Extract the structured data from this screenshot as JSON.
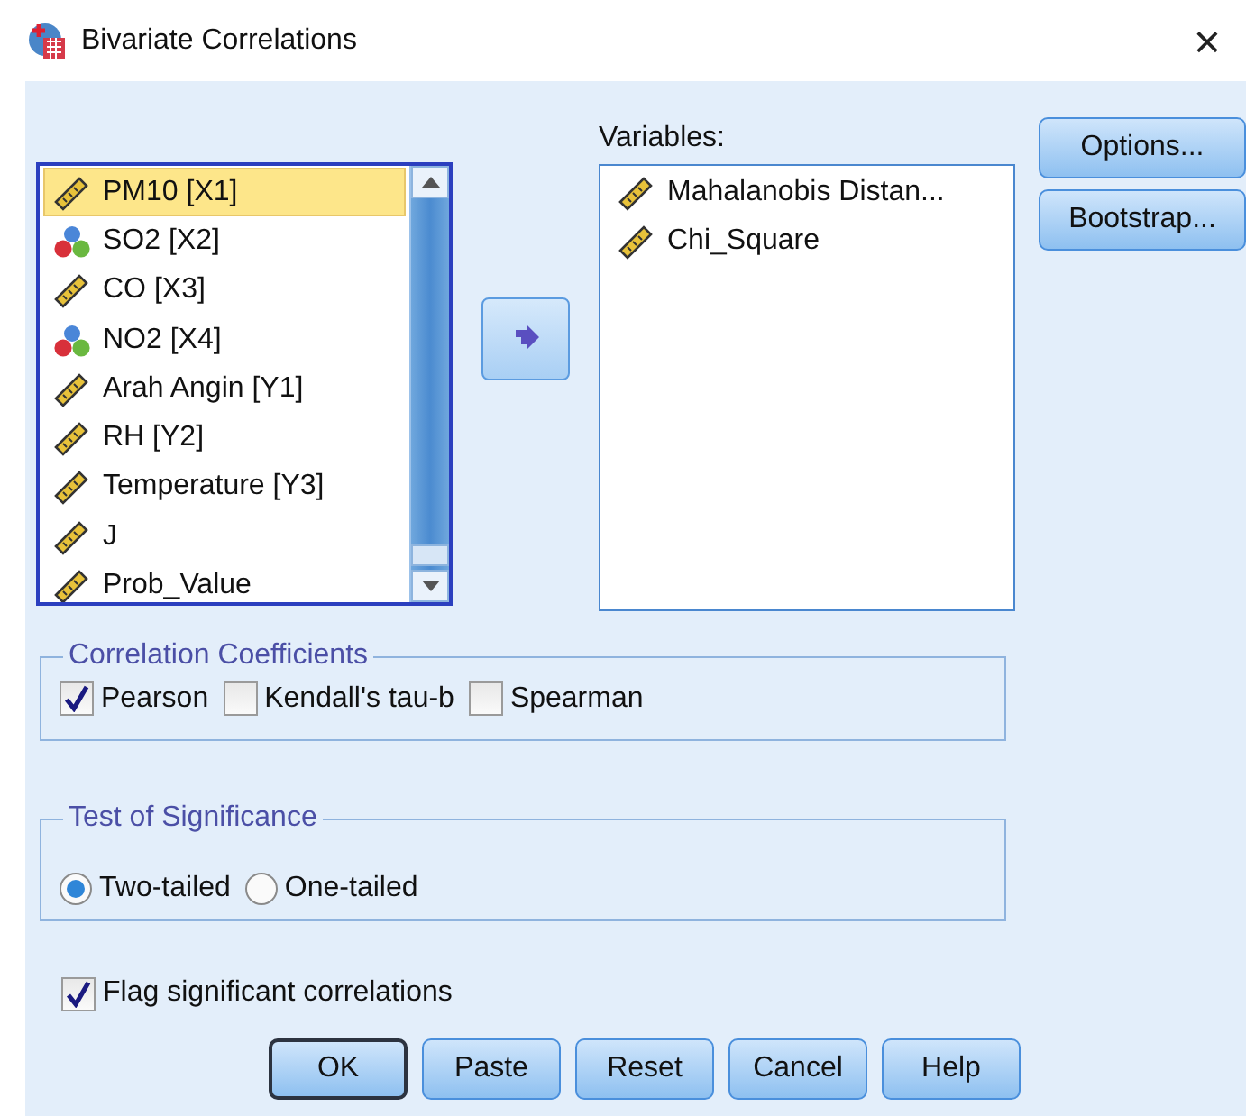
{
  "window": {
    "title": "Bivariate Correlations",
    "close": "×"
  },
  "source_list": {
    "items": [
      {
        "label": "PM10 [X1]",
        "kind": "scale",
        "selected": true
      },
      {
        "label": "SO2 [X2]",
        "kind": "nominal",
        "selected": false
      },
      {
        "label": "CO [X3]",
        "kind": "scale",
        "selected": false
      },
      {
        "label": "NO2 [X4]",
        "kind": "nominal",
        "selected": false
      },
      {
        "label": "Arah Angin [Y1]",
        "kind": "scale",
        "selected": false
      },
      {
        "label": "RH [Y2]",
        "kind": "scale",
        "selected": false
      },
      {
        "label": "Temperature [Y3]",
        "kind": "scale",
        "selected": false
      },
      {
        "label": "J",
        "kind": "scale",
        "selected": false
      },
      {
        "label": "Prob_Value",
        "kind": "scale",
        "selected": false
      }
    ]
  },
  "variables": {
    "label": "Variables:",
    "items": [
      {
        "label": "Mahalanobis Distan...",
        "kind": "scale",
        "selected": false
      },
      {
        "label": "Chi_Square",
        "kind": "scale",
        "selected": false
      }
    ]
  },
  "side_buttons": [
    "Options...",
    "Bootstrap..."
  ],
  "correlation_coefficients": {
    "title": "Correlation Coefficients",
    "options": [
      {
        "label": "Pearson",
        "checked": true
      },
      {
        "label": "Kendall's tau-b",
        "checked": false
      },
      {
        "label": "Spearman",
        "checked": false
      }
    ]
  },
  "test_of_significance": {
    "title": "Test of Significance",
    "options": [
      {
        "label": "Two-tailed",
        "selected": true
      },
      {
        "label": "One-tailed",
        "selected": false
      }
    ]
  },
  "flag_significant": {
    "label": "Flag significant correlations",
    "checked": true
  },
  "buttons": [
    {
      "label": "OK",
      "default": true
    },
    {
      "label": "Paste",
      "default": false
    },
    {
      "label": "Reset",
      "default": false
    },
    {
      "label": "Cancel",
      "default": false
    },
    {
      "label": "Help",
      "default": false
    }
  ]
}
